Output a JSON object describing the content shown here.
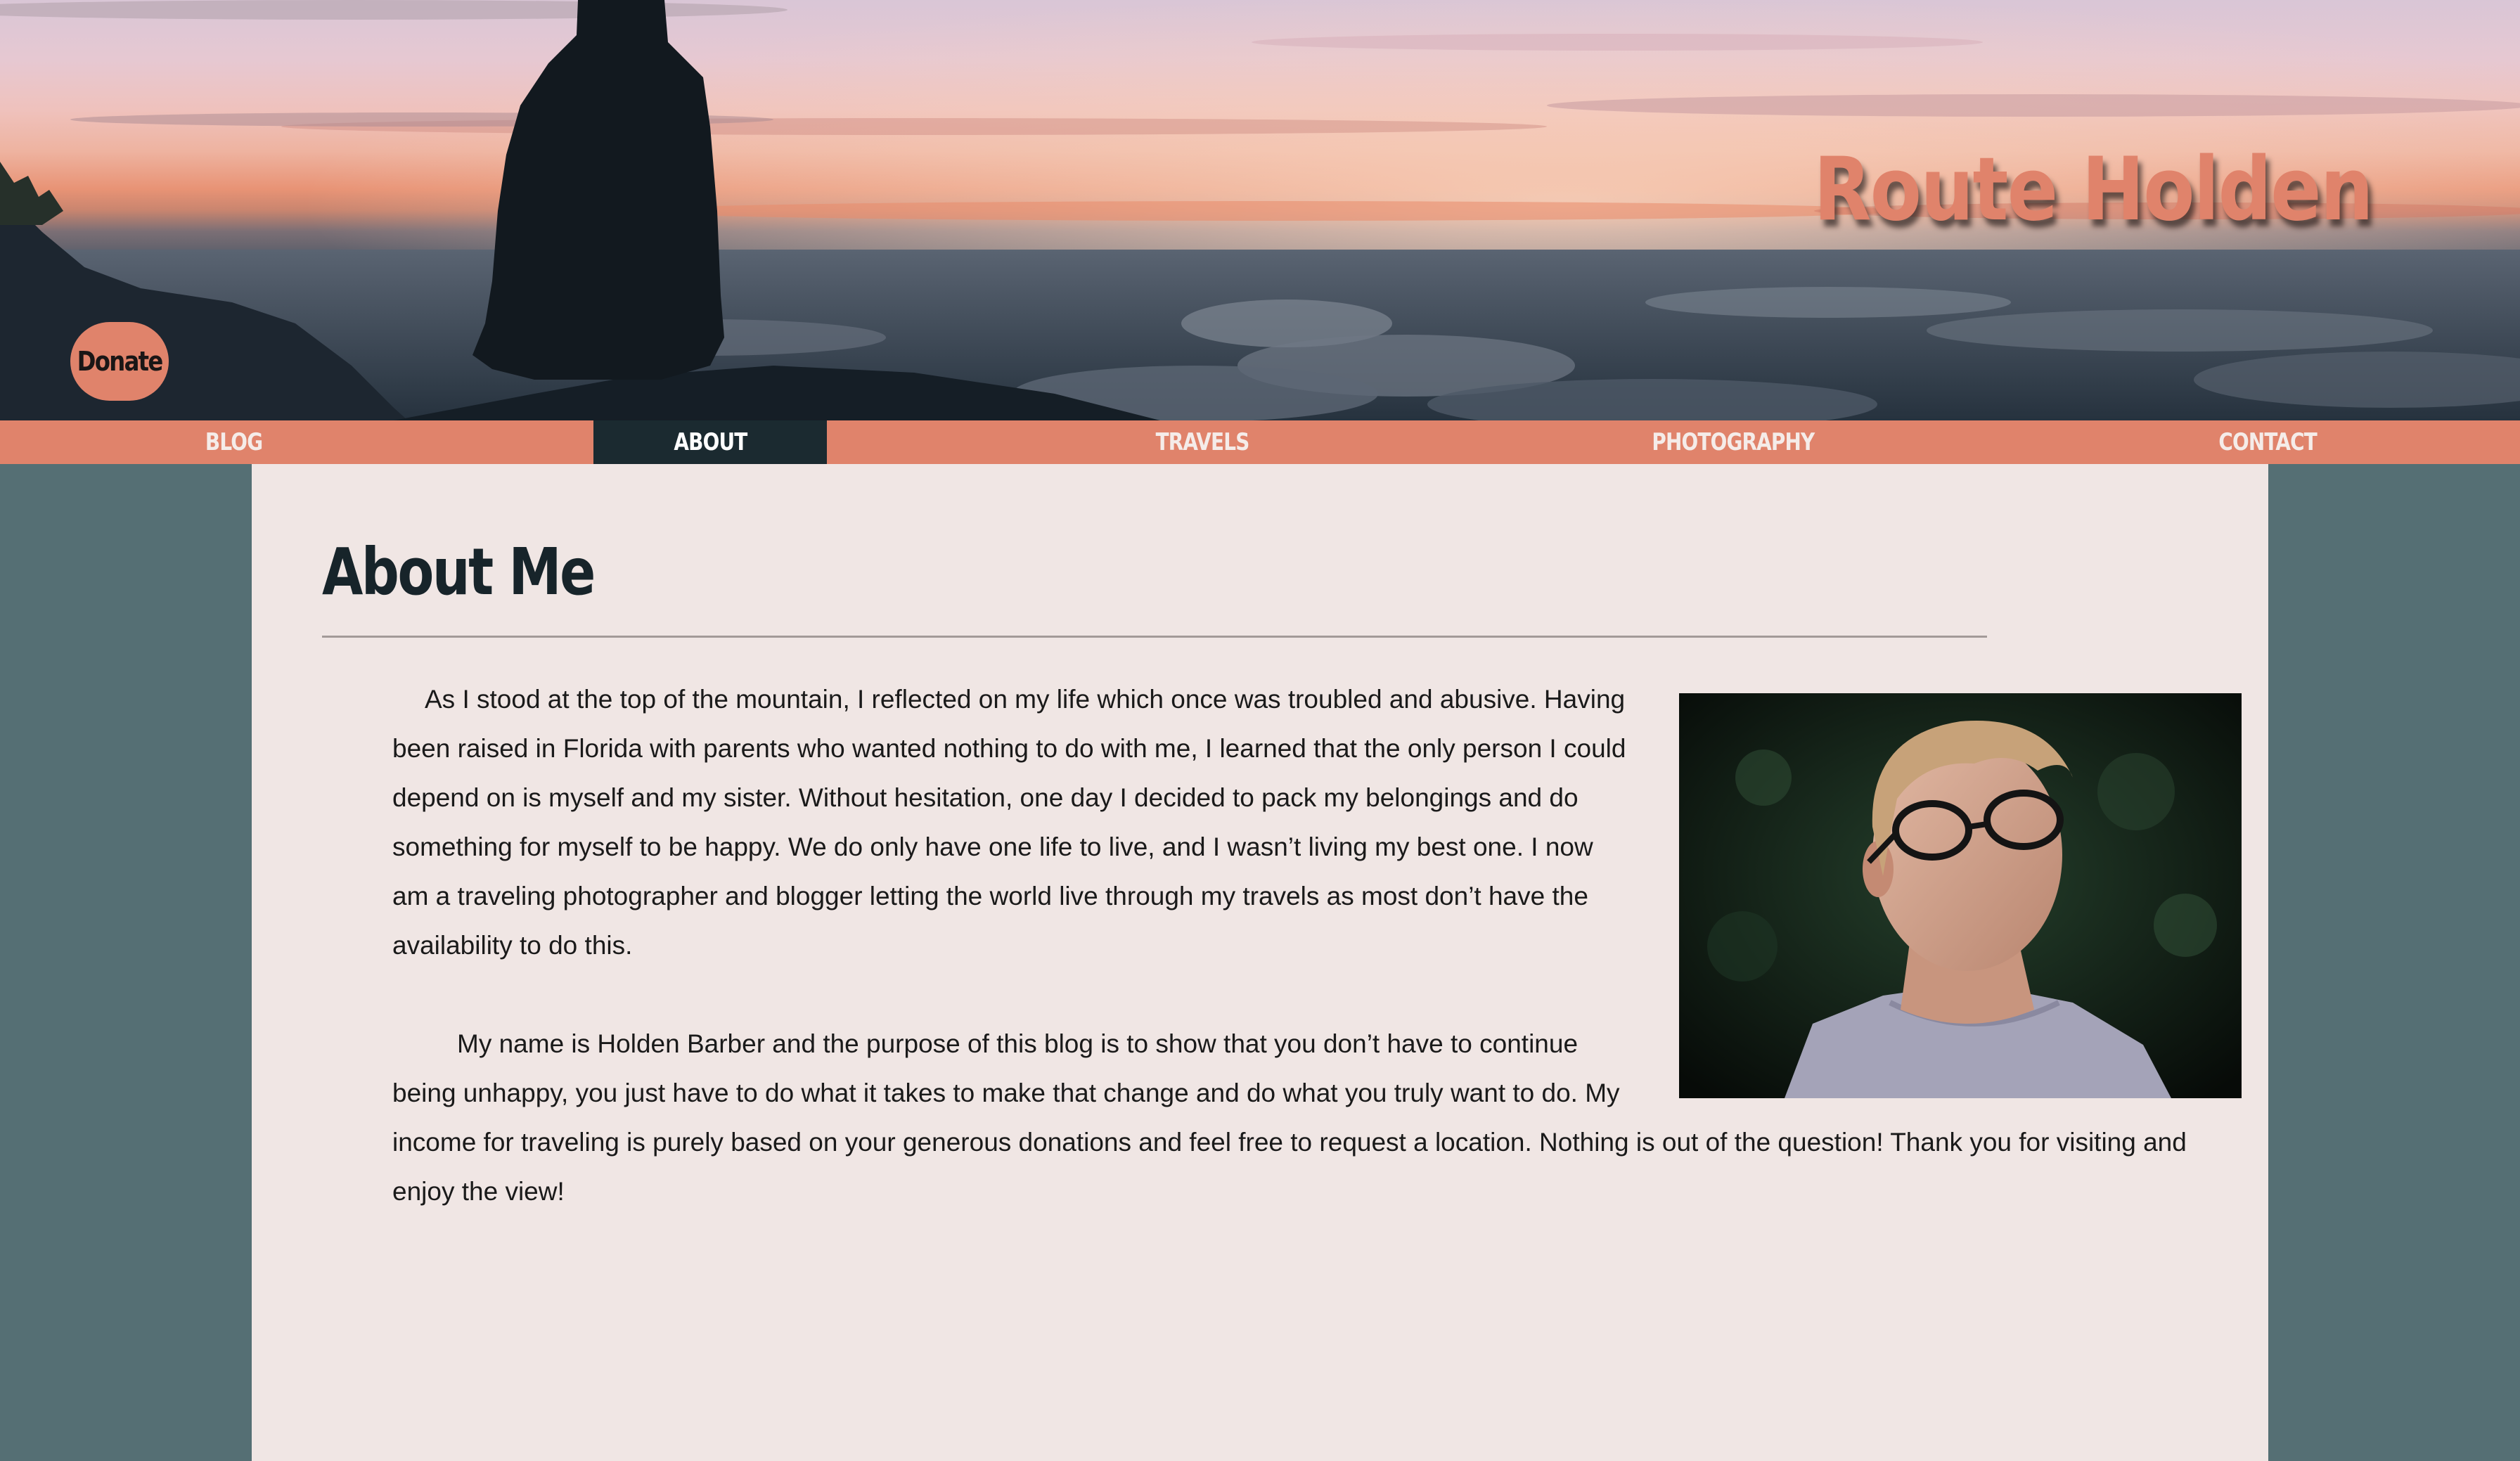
{
  "site": {
    "title": "Route Holden",
    "donate_label": "Donate"
  },
  "nav": {
    "items": [
      {
        "label": "BLOG"
      },
      {
        "label": "ABOUT"
      },
      {
        "label": "TRAVELS"
      },
      {
        "label": "PHOTOGRAPHY"
      },
      {
        "label": "CONTACT"
      }
    ],
    "active": "ABOUT"
  },
  "about": {
    "title": "About Me",
    "paragraphs": [
      "As I stood at the top of the mountain, I reflected on my life which once was troubled and abusive. Having been raised in Florida with parents who wanted nothing to do with me, I learned that the only person I could depend on is myself and my sister. Without hesitation, one day I decided to pack my belongings and do something for myself to be happy. We do only have one life to live, and I wasn’t living my best one. I now am a traveling photographer and blogger letting the world live through my travels as most don’t have the availability to do this.",
      "My name is Holden Barber and the purpose of this blog is to show that you don’t have to continue being unhappy, you just have to do what it takes to make that change and do what you truly want to do. My income for traveling is purely based on your generous donations and feel free to request a location. Nothing is out of the question! Thank you for visiting and enjoy the view!"
    ]
  },
  "colors": {
    "accent": "#e0836b",
    "nav_active": "#1b2a30",
    "page_background": "#556f74",
    "card_background": "#f0e6e4",
    "heading": "#17242a"
  },
  "images": {
    "hero": "hero-sunset-mountain-photo",
    "portrait": "portrait-photo-man-with-glasses"
  }
}
